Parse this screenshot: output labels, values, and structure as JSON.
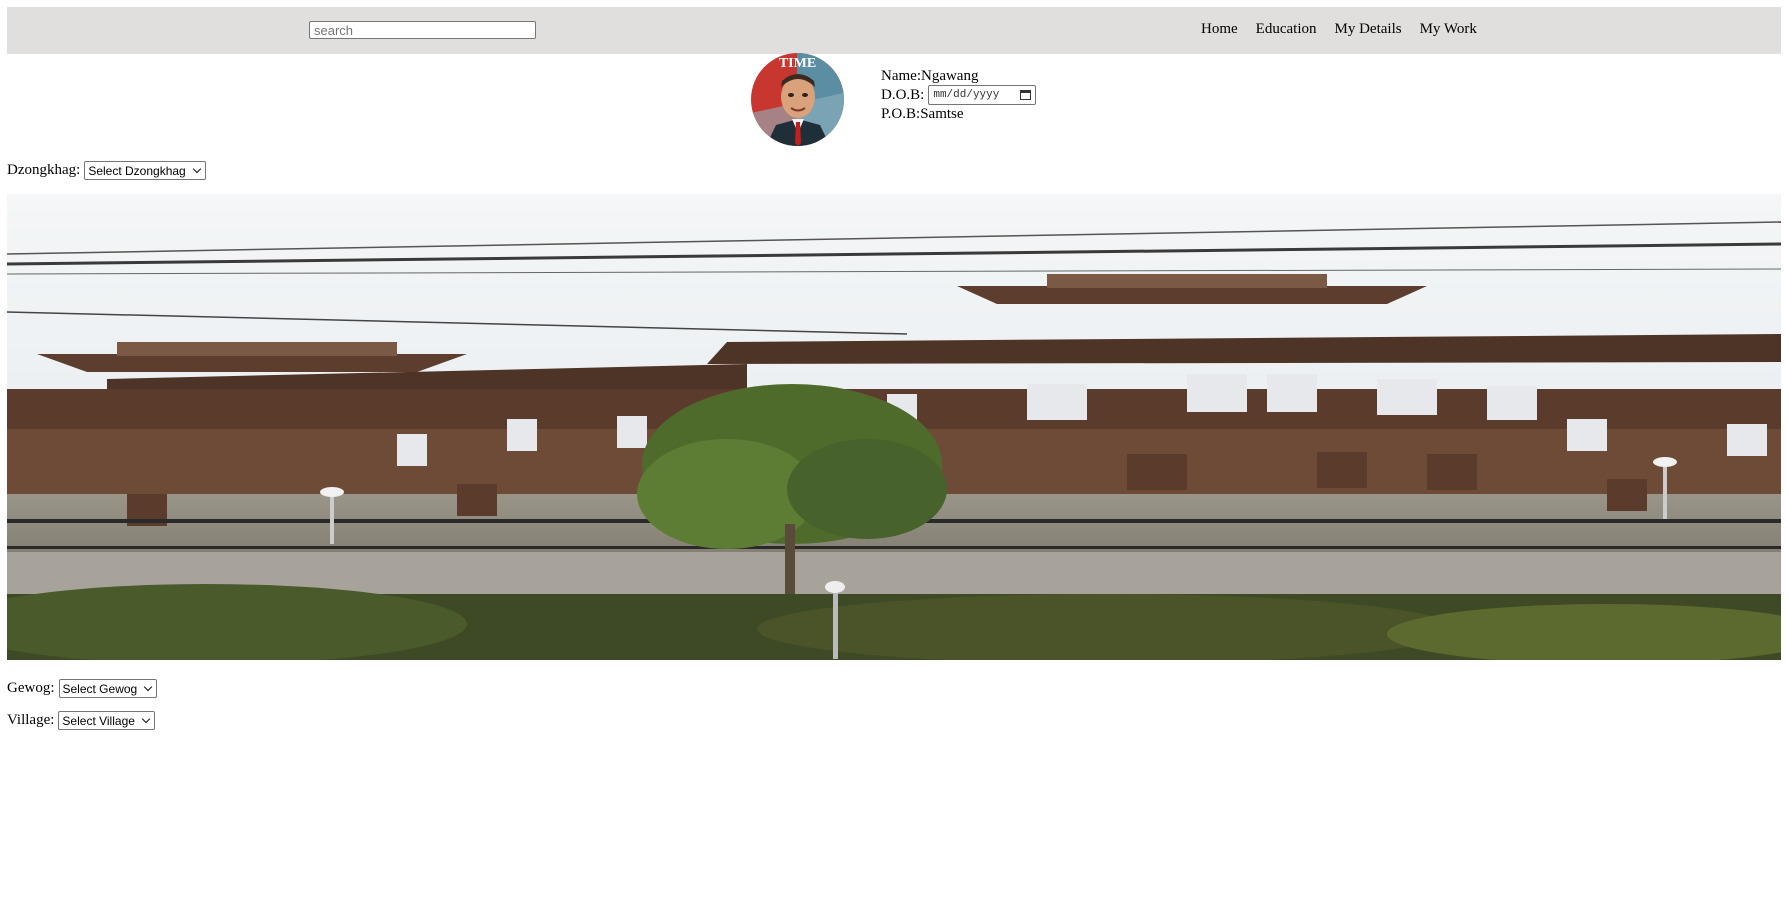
{
  "header": {
    "search_placeholder": "search",
    "nav": [
      "Home",
      "Education",
      "My Details",
      "My Work"
    ]
  },
  "profile": {
    "name_label": "Name:",
    "name": "Ngawang",
    "dob_label": "D.O.B:",
    "dob_placeholder": "mm/dd/yyyy",
    "pob_label": "P.O.B:",
    "pob": "Samtse",
    "avatar_caption": "TIME"
  },
  "form": {
    "dzongkhag_label": "Dzongkhag:",
    "dzongkhag_selected": "Select Dzongkhag",
    "gewog_label": "Gewog:",
    "gewog_selected": "Select Gewog",
    "village_label": "Village:",
    "village_selected": "Select Village"
  },
  "colors": {
    "topbar": "#e0dfdd",
    "sky": "#e8edf0",
    "roof": "#6a4a3a"
  }
}
